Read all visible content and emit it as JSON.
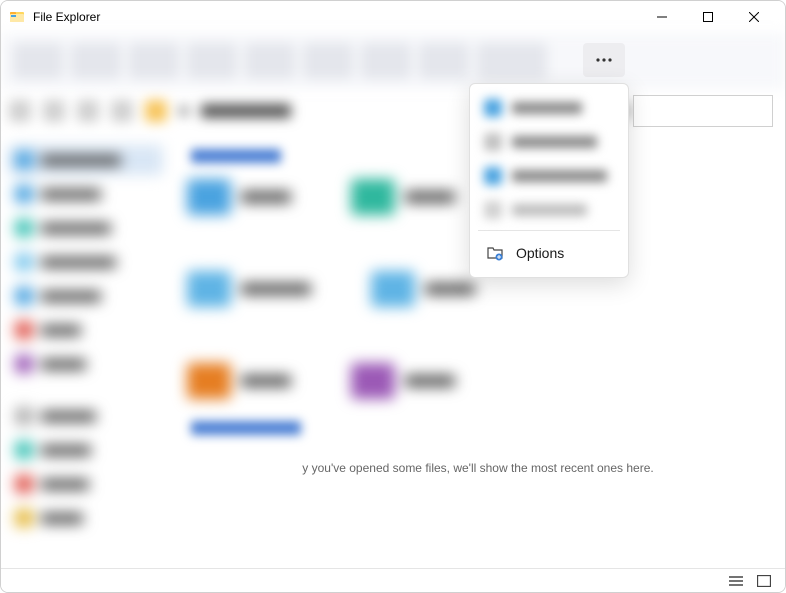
{
  "window": {
    "title": "File Explorer"
  },
  "menu": {
    "options_label": "Options"
  },
  "main": {
    "recent_text": "y you've opened some files, we'll show the most recent ones here."
  }
}
